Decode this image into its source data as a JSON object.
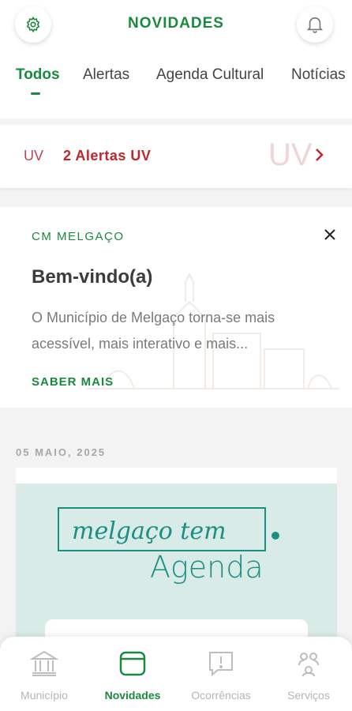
{
  "header": {
    "title": "NOVIDADES",
    "settings_icon": "gear-icon",
    "notifications_icon": "bell-icon"
  },
  "tabs": [
    {
      "label": "Todos",
      "active": true
    },
    {
      "label": "Alertas",
      "active": false
    },
    {
      "label": "Agenda Cultural",
      "active": false
    },
    {
      "label": "Notícias",
      "active": false
    }
  ],
  "uv_alert": {
    "label": "UV",
    "text": "2 Alertas UV",
    "watermark": "UV",
    "color": "#c0272d"
  },
  "welcome": {
    "source": "CM MELGAÇO",
    "title": "Bem-vindo(a)",
    "body": "O Município de Melgaço torna-se mais acessível, mais interativo e mais...",
    "link": "SABER MAIS"
  },
  "feed": {
    "date": "05 MAIO, 2025",
    "logo_text": "melgaço tem",
    "logo_subtitle": "Agenda"
  },
  "bottom_nav": [
    {
      "label": "Município",
      "icon": "bank-icon",
      "active": false
    },
    {
      "label": "Novidades",
      "icon": "news-icon",
      "active": true
    },
    {
      "label": "Ocorrências",
      "icon": "report-icon",
      "active": false
    },
    {
      "label": "Serviços",
      "icon": "services-icon",
      "active": false
    }
  ],
  "colors": {
    "brand": "#1a8a3c",
    "alert": "#c0272d",
    "agenda": "#1b8f86"
  }
}
